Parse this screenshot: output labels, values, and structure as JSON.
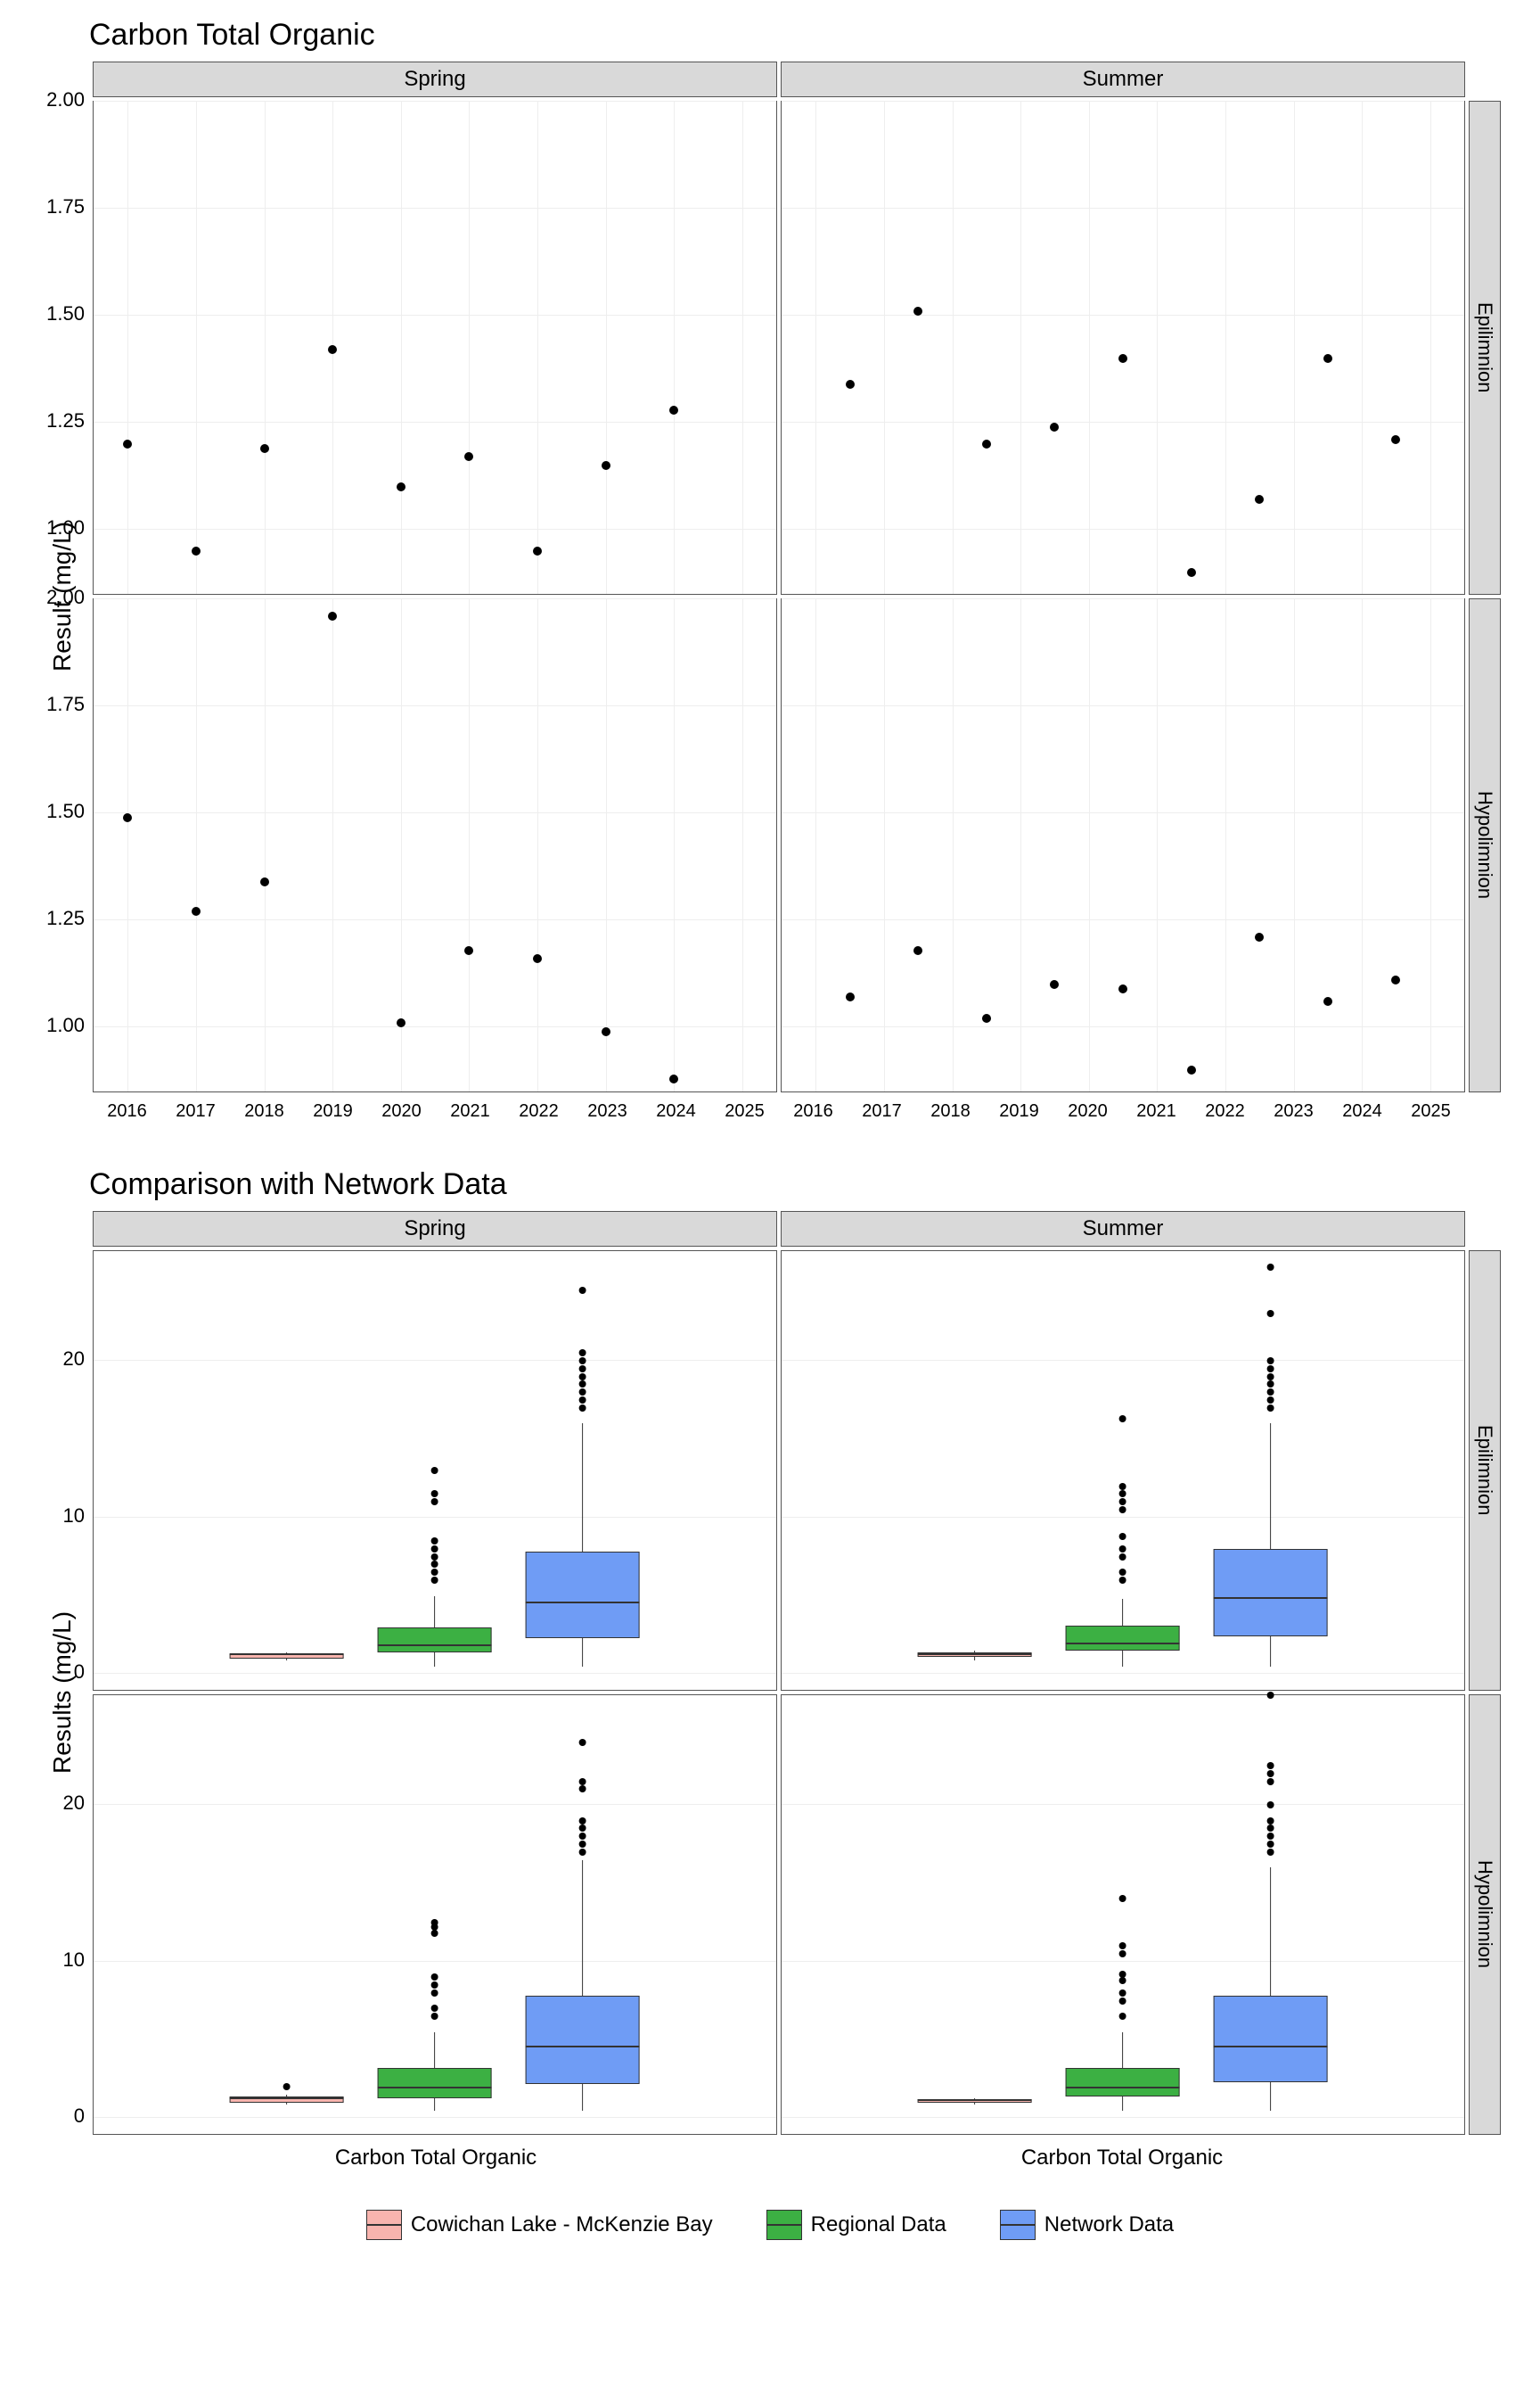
{
  "chart_data": [
    {
      "type": "scatter",
      "title": "Carbon Total Organic",
      "ylabel": "Result (mg/L)",
      "xlabel": "",
      "xlim": [
        2015.5,
        2025.5
      ],
      "ylim": [
        0.85,
        2.0
      ],
      "x_ticks": [
        2016,
        2017,
        2018,
        2019,
        2020,
        2021,
        2022,
        2023,
        2024,
        2025
      ],
      "y_ticks": [
        1.0,
        1.25,
        1.5,
        1.75,
        2.0
      ],
      "facets_col": [
        "Spring",
        "Summer"
      ],
      "facets_row": [
        "Epilimnion",
        "Hypolimnion"
      ],
      "panels": {
        "Spring_Epilimnion": {
          "x": [
            2016,
            2017,
            2018,
            2019,
            2020,
            2021,
            2022,
            2023,
            2024
          ],
          "y": [
            1.2,
            0.95,
            1.19,
            1.42,
            1.1,
            1.17,
            0.95,
            1.15,
            1.28
          ]
        },
        "Summer_Epilimnion": {
          "x": [
            2016.5,
            2017.5,
            2018.5,
            2019.5,
            2020.5,
            2021.5,
            2022.5,
            2023.5,
            2024.5
          ],
          "y": [
            1.34,
            1.51,
            1.2,
            1.24,
            1.4,
            0.9,
            1.07,
            1.4,
            1.21
          ]
        },
        "Spring_Hypolimnion": {
          "x": [
            2016,
            2017,
            2018,
            2019,
            2020,
            2021,
            2022,
            2023,
            2024
          ],
          "y": [
            1.49,
            1.27,
            1.34,
            1.96,
            1.01,
            1.18,
            1.16,
            0.99,
            0.88
          ]
        },
        "Summer_Hypolimnion": {
          "x": [
            2016.5,
            2017.5,
            2018.5,
            2019.5,
            2020.5,
            2021.5,
            2022.5,
            2023.5,
            2024.5
          ],
          "y": [
            1.07,
            1.18,
            1.02,
            1.1,
            1.09,
            0.9,
            1.21,
            1.06,
            1.11
          ]
        }
      }
    },
    {
      "type": "boxplot",
      "title": "Comparison with Network Data",
      "ylabel": "Results (mg/L)",
      "xlabel": "Carbon Total Organic",
      "ylim": [
        -1,
        27
      ],
      "y_ticks": [
        0,
        10,
        20
      ],
      "facets_col": [
        "Spring",
        "Summer"
      ],
      "facets_row": [
        "Epilimnion",
        "Hypolimnion"
      ],
      "series_names": [
        "Cowichan Lake - McKenzie Bay",
        "Regional Data",
        "Network Data"
      ],
      "series_colors": [
        "#f8766d",
        "#2ca02c",
        "#6699ff"
      ],
      "panels": {
        "Spring_Epilimnion": [
          {
            "q1": 1.0,
            "median": 1.2,
            "q3": 1.3,
            "lw": 0.9,
            "uw": 1.4,
            "outliers": []
          },
          {
            "q1": 1.4,
            "median": 1.8,
            "q3": 3.0,
            "lw": 0.5,
            "uw": 5.0,
            "outliers": [
              6.0,
              6.5,
              7.0,
              7.5,
              8.0,
              8.5,
              11.0,
              11.5,
              13.0
            ]
          },
          {
            "q1": 2.3,
            "median": 4.5,
            "q3": 7.8,
            "lw": 0.5,
            "uw": 16.0,
            "outliers": [
              17.0,
              17.5,
              18.0,
              18.5,
              19.0,
              19.5,
              20.0,
              20.5,
              24.5
            ]
          }
        ],
        "Summer_Epilimnion": [
          {
            "q1": 1.1,
            "median": 1.2,
            "q3": 1.4,
            "lw": 0.9,
            "uw": 1.5,
            "outliers": []
          },
          {
            "q1": 1.5,
            "median": 1.9,
            "q3": 3.1,
            "lw": 0.5,
            "uw": 4.8,
            "outliers": [
              6.0,
              6.5,
              7.5,
              8.0,
              8.8,
              10.5,
              11.0,
              11.5,
              12.0,
              16.3
            ]
          },
          {
            "q1": 2.4,
            "median": 4.8,
            "q3": 8.0,
            "lw": 0.5,
            "uw": 16.0,
            "outliers": [
              17.0,
              17.5,
              18.0,
              18.5,
              19.0,
              19.5,
              20.0,
              23.0,
              26.0
            ]
          }
        ],
        "Spring_Hypolimnion": [
          {
            "q1": 1.0,
            "median": 1.2,
            "q3": 1.4,
            "lw": 0.9,
            "uw": 1.5,
            "outliers": [
              2.0
            ]
          },
          {
            "q1": 1.3,
            "median": 1.9,
            "q3": 3.2,
            "lw": 0.5,
            "uw": 5.5,
            "outliers": [
              6.5,
              7.0,
              8.0,
              8.5,
              9.0,
              11.8,
              12.2,
              12.5
            ]
          },
          {
            "q1": 2.2,
            "median": 4.5,
            "q3": 7.8,
            "lw": 0.5,
            "uw": 16.5,
            "outliers": [
              17.0,
              17.5,
              18.0,
              18.5,
              19.0,
              21.0,
              21.5,
              24.0
            ]
          }
        ],
        "Summer_Hypolimnion": [
          {
            "q1": 1.0,
            "median": 1.1,
            "q3": 1.2,
            "lw": 0.9,
            "uw": 1.3,
            "outliers": []
          },
          {
            "q1": 1.4,
            "median": 1.9,
            "q3": 3.2,
            "lw": 0.5,
            "uw": 5.5,
            "outliers": [
              6.5,
              7.5,
              8.0,
              8.8,
              9.2,
              10.5,
              11.0,
              14.0
            ]
          },
          {
            "q1": 2.3,
            "median": 4.5,
            "q3": 7.8,
            "lw": 0.5,
            "uw": 16.0,
            "outliers": [
              17.0,
              17.5,
              18.0,
              18.5,
              19.0,
              20.0,
              21.5,
              22.0,
              22.5,
              27.0
            ]
          }
        ]
      }
    }
  ],
  "legend": {
    "items": [
      {
        "label": "Cowichan Lake - McKenzie Bay",
        "color": "#f8766d"
      },
      {
        "label": "Regional Data",
        "color": "#2ca02c"
      },
      {
        "label": "Network Data",
        "color": "#6699ff"
      }
    ]
  }
}
